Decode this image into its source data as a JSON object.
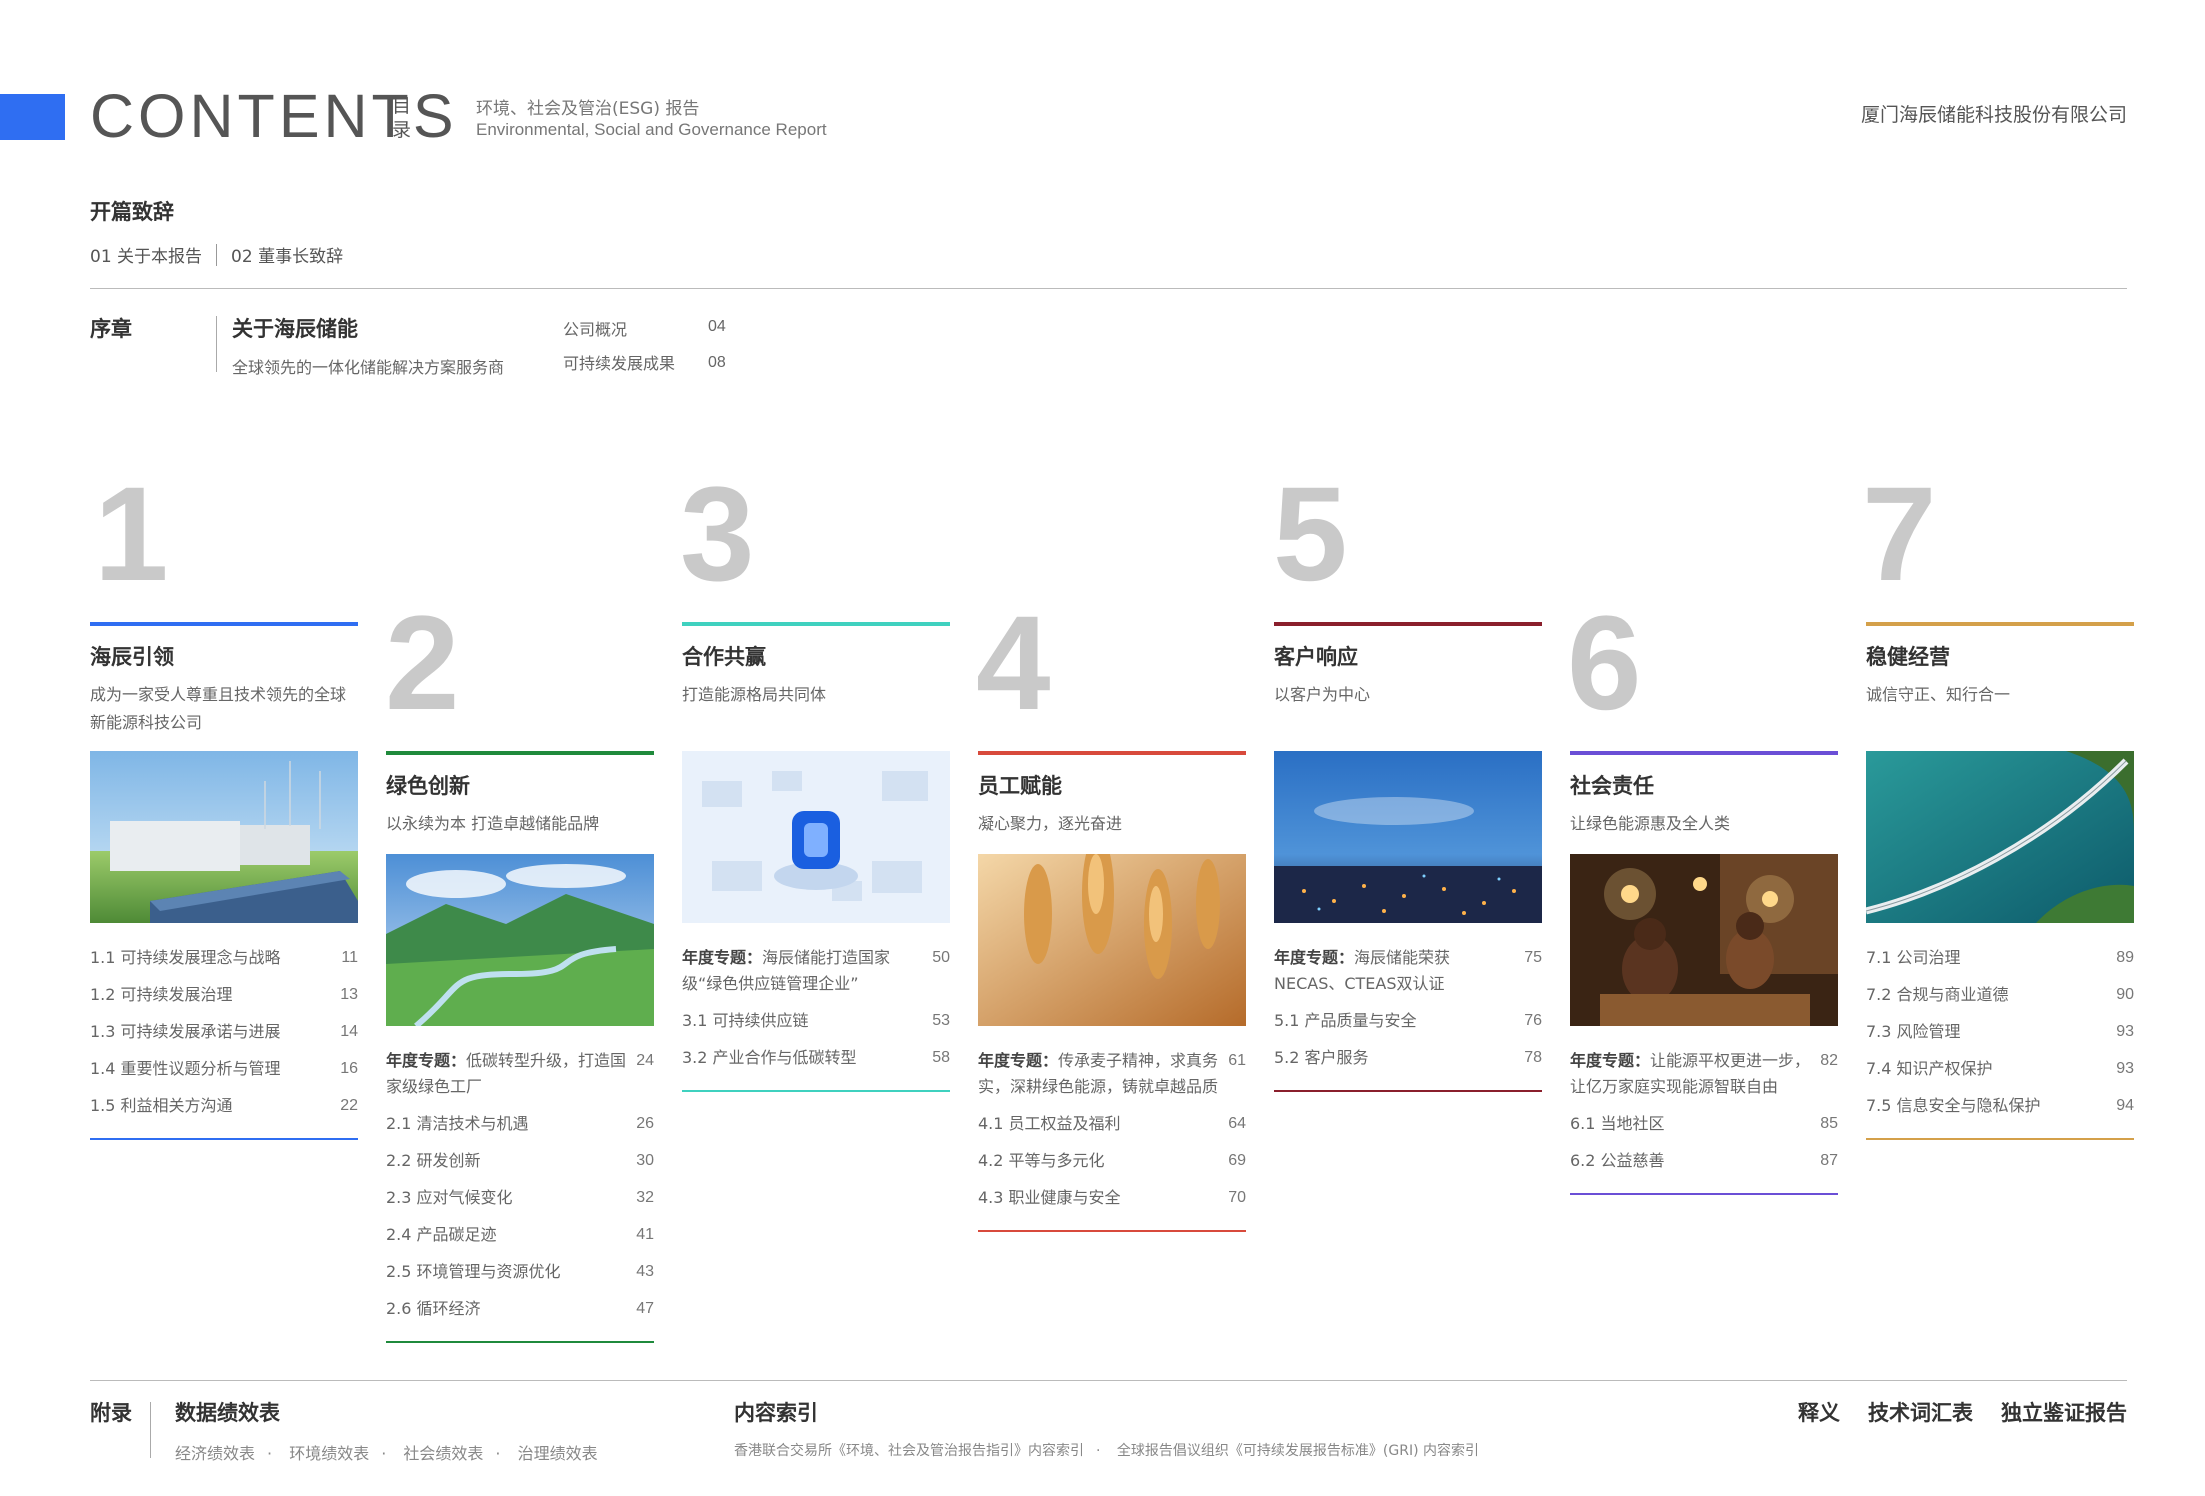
{
  "header": {
    "contents_word": "CONTENTS",
    "mulu": "目录",
    "report_zh": "环境、社会及管治(ESG) 报告",
    "report_en": "Environmental, Social and Governance Report",
    "company": "厦门海辰储能科技股份有限公司"
  },
  "opening": {
    "title": "开篇致辞",
    "link1": "01 关于本报告",
    "link2": "02 董事长致辞"
  },
  "prologue": {
    "title": "序章",
    "about_title": "关于海辰储能",
    "about_sub": "全球领先的一体化储能解决方案服务商",
    "items": [
      {
        "label": "公司概况",
        "page": "04"
      },
      {
        "label": "可持续发展成果",
        "page": "08"
      }
    ]
  },
  "colors": {
    "s1": "#2f6ef2",
    "s2": "#1f8a3c",
    "s3": "#3fd1bf",
    "s4": "#d84a3c",
    "s5": "#8a1f2c",
    "s6": "#6b4fd6",
    "s7": "#d4a04a"
  },
  "sections": [
    {
      "num": "1",
      "title": "海辰引领",
      "sub": "成为一家受人尊重且技术领先的全球新能源科技公司",
      "image": "solar-panels-wind-turbines",
      "items": [
        {
          "label": "1.1 可持续发展理念与战略",
          "page": "11"
        },
        {
          "label": "1.2 可持续发展治理",
          "page": "13"
        },
        {
          "label": "1.3 可持续发展承诺与进展",
          "page": "14"
        },
        {
          "label": "1.4 重要性议题分析与管理",
          "page": "16"
        },
        {
          "label": "1.5 利益相关方沟通",
          "page": "22"
        }
      ]
    },
    {
      "num": "2",
      "title": "绿色创新",
      "sub": "以永续为本 打造卓越储能品牌",
      "image": "green-valley-river",
      "feature_bold": "年度专题：",
      "feature": "低碳转型升级，打造国家级绿色工厂",
      "feature_page": "24",
      "items": [
        {
          "label": "2.1 清洁技术与机遇",
          "page": "26"
        },
        {
          "label": "2.2 研发创新",
          "page": "30"
        },
        {
          "label": "2.3 应对气候变化",
          "page": "32"
        },
        {
          "label": "2.4 产品碳足迹",
          "page": "41"
        },
        {
          "label": "2.5 环境管理与资源优化",
          "page": "43"
        },
        {
          "label": "2.6 循环经济",
          "page": "47"
        }
      ]
    },
    {
      "num": "3",
      "title": "合作共赢",
      "sub": "打造能源格局共同体",
      "image": "isometric-blue-hub",
      "feature_bold": "年度专题：",
      "feature": "海辰储能打造国家级“绿色供应链管理企业”",
      "feature_page": "50",
      "items": [
        {
          "label": "3.1 可持续供应链",
          "page": "53"
        },
        {
          "label": "3.2 产业合作与低碳转型",
          "page": "58"
        }
      ]
    },
    {
      "num": "4",
      "title": "员工赋能",
      "sub": "凝心聚力，逐光奋进",
      "image": "wheat-closeup",
      "feature_bold": "年度专题：",
      "feature": "传承麦子精神，求真务实，深耕绿色能源，铸就卓越品质",
      "feature_page": "61",
      "items": [
        {
          "label": "4.1 员工权益及福利",
          "page": "64"
        },
        {
          "label": "4.2 平等与多元化",
          "page": "69"
        },
        {
          "label": "4.3 职业健康与安全",
          "page": "70"
        }
      ]
    },
    {
      "num": "5",
      "title": "客户响应",
      "sub": "以客户为中心",
      "image": "city-night-lights",
      "feature_bold": "年度专题：",
      "feature": "海辰储能荣获NECAS、CTEAS双认证",
      "feature_page": "75",
      "items": [
        {
          "label": "5.1 产品质量与安全",
          "page": "76"
        },
        {
          "label": "5.2 客户服务",
          "page": "78"
        }
      ]
    },
    {
      "num": "6",
      "title": "社会责任",
      "sub": "让绿色能源惠及全人类",
      "image": "children-reading-under-light",
      "feature_bold": "年度专题：",
      "feature": "让能源平权更进一步，让亿万家庭实现能源智联自由",
      "feature_page": "82",
      "items": [
        {
          "label": "6.1 当地社区",
          "page": "85"
        },
        {
          "label": "6.2 公益慈善",
          "page": "87"
        }
      ]
    },
    {
      "num": "7",
      "title": "稳健经营",
      "sub": "诚信守正、知行合一",
      "image": "bridge-over-sea",
      "items": [
        {
          "label": "7.1 公司治理",
          "page": "89"
        },
        {
          "label": "7.2 合规与商业道德",
          "page": "90"
        },
        {
          "label": "7.3 风险管理",
          "page": "93"
        },
        {
          "label": "7.4 知识产权保护",
          "page": "93"
        },
        {
          "label": "7.5 信息安全与隐私保护",
          "page": "94"
        }
      ]
    }
  ],
  "footer": {
    "appendix": "附录",
    "data_title": "数据绩效表",
    "data_items": [
      "经济绩效表",
      "环境绩效表",
      "社会绩效表",
      "治理绩效表"
    ],
    "index_title": "内容索引",
    "index_items": [
      "香港联合交易所《环境、社会及管治报告指引》内容索引",
      "全球报告倡议组织《可持续发展报告标准》(GRI) 内容索引"
    ],
    "right": [
      "释义",
      "技术词汇表",
      "独立鉴证报告"
    ]
  }
}
